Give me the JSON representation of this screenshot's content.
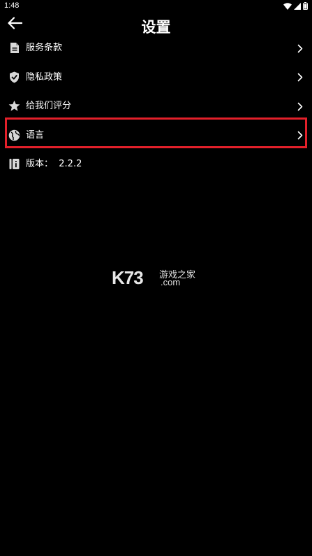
{
  "status_bar": {
    "time": "1:48",
    "icons": [
      "wifi-icon",
      "signal-icon",
      "battery-icon"
    ]
  },
  "header": {
    "title": "设置",
    "back_icon": "arrow-left-icon"
  },
  "settings": {
    "items": [
      {
        "label": "服务条款",
        "icon": "document-icon",
        "has_chevron": true
      },
      {
        "label": "隐私政策",
        "icon": "shield-check-icon",
        "has_chevron": true
      },
      {
        "label": "给我们评分",
        "icon": "star-icon",
        "has_chevron": true
      },
      {
        "label": "语言",
        "icon": "globe-icon",
        "has_chevron": true,
        "highlighted": true
      },
      {
        "label": "版本：  2.2.2",
        "icon": "info-icon",
        "has_chevron": false
      }
    ]
  },
  "watermark": {
    "logo": "K73",
    "text": "游戏之家",
    "domain": ".com"
  },
  "colors": {
    "background": "#000000",
    "text": "#ffffff",
    "highlight_border": "#e3202a"
  }
}
